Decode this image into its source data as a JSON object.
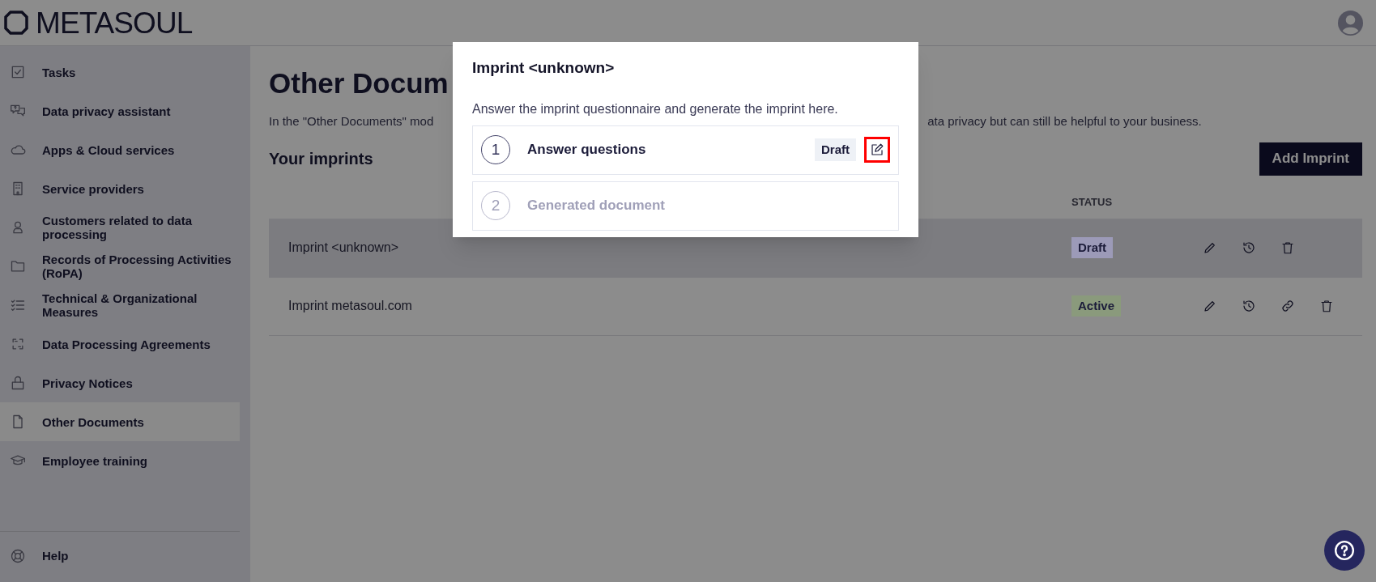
{
  "header": {
    "logo_text": "METASOUL"
  },
  "sidebar": {
    "items": [
      {
        "label": "Tasks",
        "selected": false
      },
      {
        "label": "Data privacy assistant",
        "selected": false
      },
      {
        "label": "Apps & Cloud services",
        "selected": false
      },
      {
        "label": "Service providers",
        "selected": false
      },
      {
        "label": "Customers related to data processing",
        "selected": false
      },
      {
        "label": "Records of Processing Activities (RoPA)",
        "selected": false
      },
      {
        "label": "Technical & Organizational Measures",
        "selected": false
      },
      {
        "label": "Data Processing Agreements",
        "selected": false
      },
      {
        "label": "Privacy Notices",
        "selected": false
      },
      {
        "label": "Other Documents",
        "selected": true
      },
      {
        "label": "Employee training",
        "selected": false
      }
    ],
    "footer_items": [
      {
        "label": "Help"
      }
    ]
  },
  "main": {
    "title": "Other Docum",
    "description_left": "In the \"Other Documents\" mod",
    "description_right": "ata privacy but can still be helpful to your business.",
    "section_title": "Your imprints",
    "add_button": "Add Imprint",
    "table": {
      "columns": [
        {
          "label": "STATUS"
        }
      ],
      "rows": [
        {
          "name": "Imprint <unknown>",
          "status": "Draft",
          "color": "#9c9ab8",
          "highlighted": true,
          "actions": [
            {
              "kind": "edit"
            },
            {
              "kind": "history"
            },
            {
              "kind": "delete"
            }
          ]
        },
        {
          "name": "Imprint metasoul.com",
          "status": "Active",
          "color": "#8a9a7c",
          "highlighted": false,
          "actions": [
            {
              "kind": "edit"
            },
            {
              "kind": "history"
            },
            {
              "kind": "link"
            },
            {
              "kind": "delete"
            }
          ]
        }
      ]
    }
  },
  "modal": {
    "title": "Imprint <unknown>",
    "description": "Answer the imprint questionnaire and generate the imprint here.",
    "steps": [
      {
        "number": "1",
        "label": "Answer questions",
        "disabled": false,
        "badge": "Draft",
        "edit_highlighted": true
      },
      {
        "number": "2",
        "label": "Generated document",
        "disabled": true
      }
    ]
  }
}
